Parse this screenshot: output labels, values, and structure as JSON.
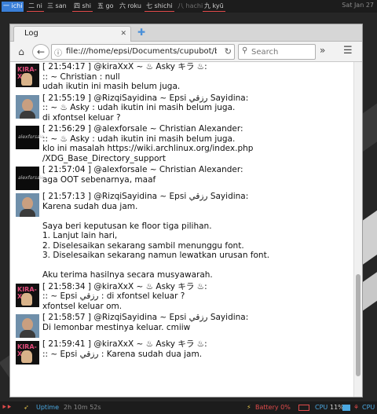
{
  "topbar": {
    "workspaces": [
      {
        "label": "一 ichi",
        "state": "active-blue"
      },
      {
        "label": "二 ni",
        "state": "active"
      },
      {
        "label": "三 san",
        "state": "normal"
      },
      {
        "label": "四 shi",
        "state": "active"
      },
      {
        "label": "五 go",
        "state": "normal"
      },
      {
        "label": "六 roku",
        "state": "normal"
      },
      {
        "label": "七 shichi",
        "state": "active"
      },
      {
        "label": "八 hachi",
        "state": "dim"
      },
      {
        "label": "九 kyū",
        "state": "active"
      }
    ],
    "clock": "Sat Jan 27"
  },
  "browser": {
    "tab_title": "Log",
    "tab_close": "✕",
    "url": "file:///home/epsi/Documents/cupubot/b",
    "search_placeholder": "Search"
  },
  "messages": [
    {
      "avatar": "kira",
      "avatar_text": "KIRA-X",
      "lines": [
        "[ 21:54:17 ] @kiraXxX ~ ♨  Asky キラ ♨:",
        ":: ~ Christian : null",
        "udah ikutin ini masih belum juga."
      ]
    },
    {
      "avatar": "rizqi",
      "lines": [
        "[ 21:55:19 ] @RizqiSayidina ~ Epsi رزقي Sayidina:",
        ":: ~ ♨  Asky : udah ikutin ini masih belum juga.",
        "di xfontsel keluar ?"
      ]
    },
    {
      "avatar": "alex",
      "avatar_text": "alexforsale",
      "lines": [
        "[ 21:56:29 ] @alexforsale ~ Christian Alexander:",
        ":: ~ ♨  Asky : udah ikutin ini masih belum juga.",
        "klo ini masalah https://wiki.archlinux.org/index.php",
        "/XDG_Base_Directory_support"
      ]
    },
    {
      "avatar": "alex",
      "avatar_text": "alexforsale",
      "lines": [
        "[ 21:57:04 ] @alexforsale ~ Christian Alexander:",
        "aga OOT sebenarnya, maaf"
      ]
    },
    {
      "avatar": "rizqi",
      "lines": [
        "[ 21:57:13 ] @RizqiSayidina ~ Epsi رزقي Sayidina:",
        "Karena sudah dua jam.",
        "",
        "Saya beri keputusan ke floor tiga pilihan.",
        "1. Lanjut lain hari,",
        "2. Diselesaikan sekarang sambil menunggu font.",
        "3. Diselesaikan sekarang namun lewatkan urusan font.",
        "",
        "Aku terima hasilnya secara musyawarah."
      ]
    },
    {
      "avatar": "kira",
      "avatar_text": "KIRA-X",
      "lines": [
        "[ 21:58:34 ] @kiraXxX ~ ♨  Asky キラ ♨:",
        ":: ~ Epsi رزقي : di xfontsel keluar ?",
        "xfontsel keluar om."
      ]
    },
    {
      "avatar": "rizqi",
      "lines": [
        "[ 21:58:57 ] @RizqiSayidina ~ Epsi رزقي Sayidina:",
        "Di lemonbar mestinya keluar. cmiiw"
      ]
    },
    {
      "avatar": "kira",
      "avatar_text": "KIRA-X",
      "lines": [
        "[ 21:59:41 ] @kiraXxX ~ ♨  Asky キラ ♨:",
        ":: ~ Epsi رزقي : Karena sudah dua jam."
      ]
    }
  ],
  "statusbar": {
    "arrows": "⯈⯈",
    "uptime_label": "Uptime",
    "uptime_value": "2h 10m 52s",
    "battery_label": "Battery 0%",
    "cpu_label": "CPU",
    "cpu_value": "11%",
    "cpu_label2": "CPU",
    "colors": {
      "accent_red": "#e14b4b",
      "accent_blue": "#4ba8e1",
      "accent_yellow": "#e1c04b"
    }
  }
}
